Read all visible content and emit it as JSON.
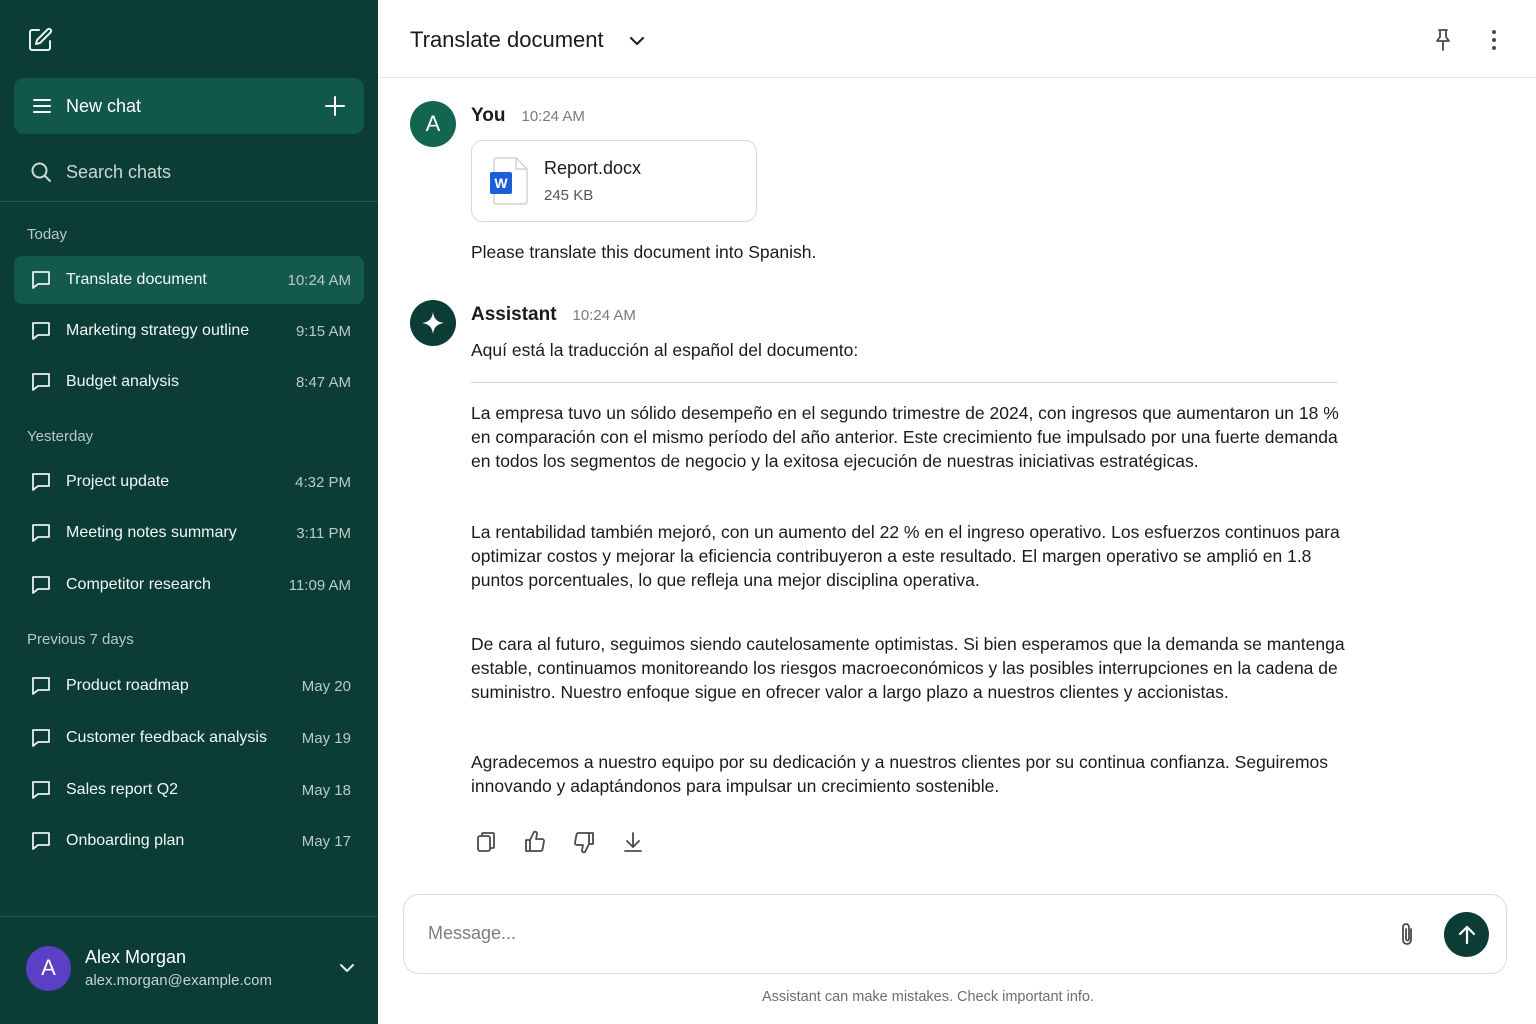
{
  "sidebar": {
    "new_chat_label": "New chat",
    "search_placeholder": "Search chats",
    "sections": {
      "today": "Today",
      "yesterday": "Yesterday",
      "previous": "Previous 7 days"
    },
    "today_items": [
      {
        "title": "Translate document",
        "time": "10:24 AM"
      },
      {
        "title": "Marketing strategy outline",
        "time": "9:15 AM"
      },
      {
        "title": "Budget analysis",
        "time": "8:47 AM"
      }
    ],
    "yesterday_items": [
      {
        "title": "Project update",
        "time": "4:32 PM"
      },
      {
        "title": "Meeting notes summary",
        "time": "3:11 PM"
      },
      {
        "title": "Competitor research",
        "time": "11:09 AM"
      }
    ],
    "previous_items": [
      {
        "title": "Product roadmap",
        "time": "May 20"
      },
      {
        "title": "Customer feedback analysis",
        "time": "May 19"
      },
      {
        "title": "Sales report Q2",
        "time": "May 18"
      },
      {
        "title": "Onboarding plan",
        "time": "May 17"
      }
    ],
    "user": {
      "initial": "A",
      "name": "Alex Morgan",
      "email": "alex.morgan@example.com"
    }
  },
  "header": {
    "title": "Translate document"
  },
  "messages": {
    "user": {
      "avatar_initial": "A",
      "name": "You",
      "time": "10:24 AM",
      "attachment": {
        "name": "Report.docx",
        "size": "245 KB",
        "icon_letter": "W"
      },
      "text": "Please translate this document into Spanish."
    },
    "assistant": {
      "name": "Assistant",
      "time": "10:24 AM",
      "intro": "Aquí está la traducción al español del documento:",
      "paragraphs": [
        "La empresa tuvo un sólido desempeño en el segundo trimestre de 2024, con ingresos que aumentaron un 18 % en comparación con el mismo período del año anterior. Este crecimiento fue impulsado por una fuerte demanda en todos los segmentos de negocio y la exitosa ejecución de nuestras iniciativas estratégicas.",
        "La rentabilidad también mejoró, con un aumento del 22 % en el ingreso operativo. Los esfuerzos continuos para optimizar costos y mejorar la eficiencia contribuyeron a este resultado. El margen operativo se amplió en 1.8 puntos porcentuales, lo que refleja una mejor disciplina operativa.",
        "De cara al futuro, seguimos siendo cautelosamente optimistas. Si bien esperamos que la demanda se mantenga estable, continuamos monitoreando los riesgos macroeconómicos y las posibles interrupciones en la cadena de suministro. Nuestro enfoque sigue en ofrecer valor a largo plazo a nuestros clientes y accionistas.",
        "Agradecemos a nuestro equipo por su dedicación y a nuestros clientes por su continua confianza. Seguiremos innovando y adaptándonos para impulsar un crecimiento sostenible."
      ]
    }
  },
  "composer": {
    "placeholder": "Message...",
    "disclaimer": "Assistant can make mistakes. Check important info."
  },
  "colors": {
    "sidebar_bg": "#0b3d36",
    "sidebar_active": "#14594d",
    "accent": "#0b3d36",
    "user_avatar": "#12664f",
    "profile_avatar": "#5b3fc4",
    "word_blue": "#1a5fd6"
  }
}
